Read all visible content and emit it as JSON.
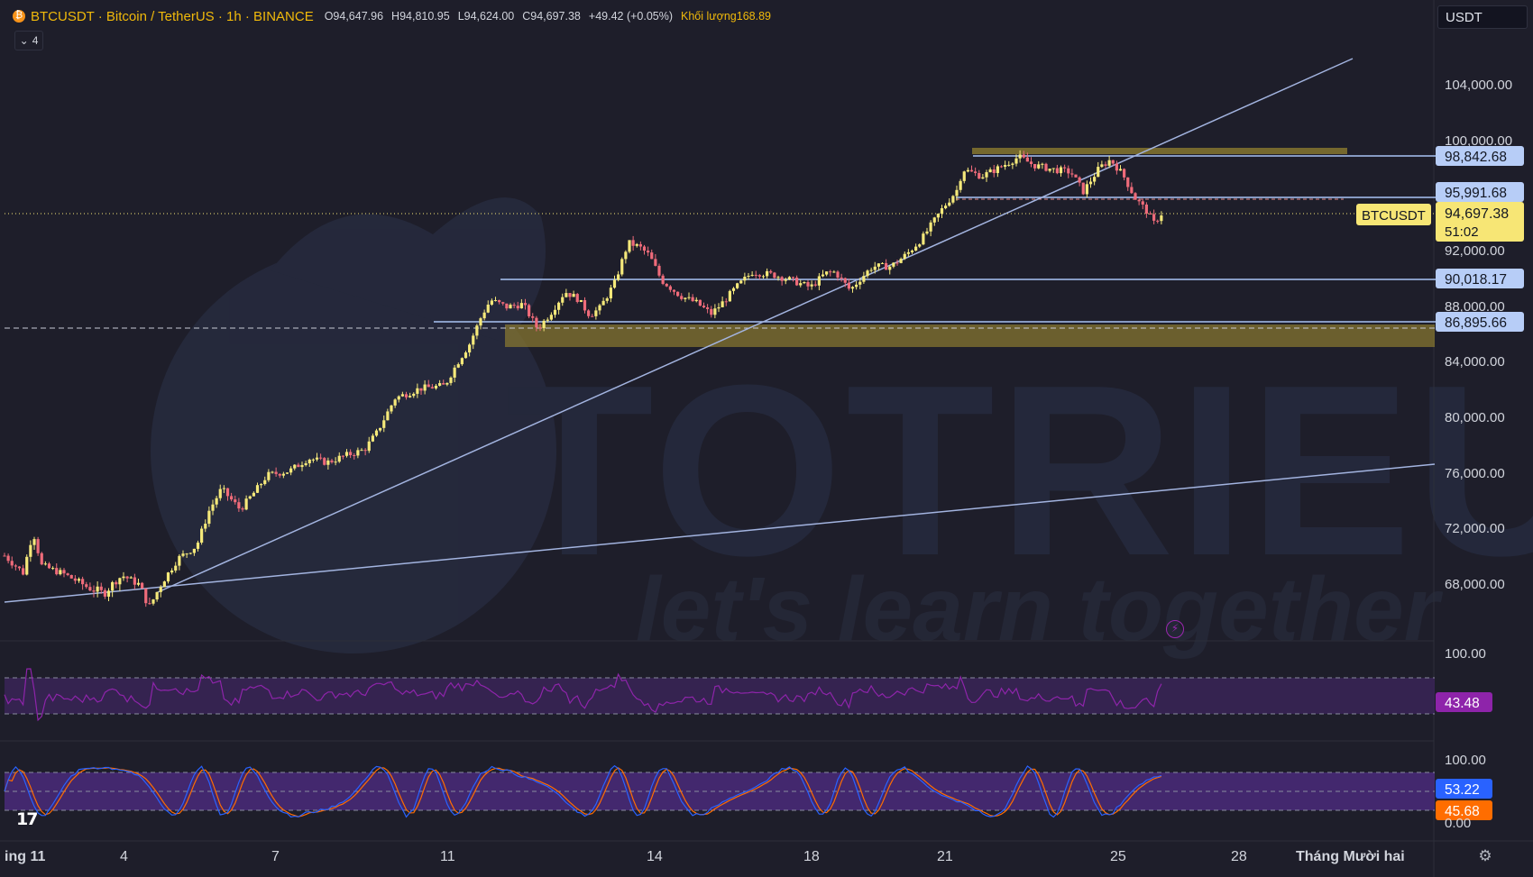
{
  "header": {
    "title": "BTCUSDT · Bitcoin / TetherUS · 1h · BINANCE",
    "open": "O94,647.96",
    "high": "H94,810.95",
    "low": "L94,624.00",
    "close": "C94,697.38",
    "change": "+49.42 (+0.05%)",
    "volume": "Khối lượng168.89",
    "indicators_toggle": "4"
  },
  "currency_selector": "USDT",
  "watermark": {
    "brand": "TOTRIEU",
    "tagline": "let's learn together"
  },
  "price_labels": {
    "symbol_tag": "BTCUSDT",
    "last_price": "94,697.38",
    "countdown": "51:02",
    "levels": [
      "98,842.68",
      "95,991.68",
      "90,018.17",
      "86,895.66"
    ]
  },
  "rsi": {
    "value": "43.48",
    "top_tick": "100.00"
  },
  "stoch_rsi": {
    "k": "53.22",
    "d": "45.68",
    "top_tick": "100.00",
    "bottom_tick": "0.00"
  },
  "colors": {
    "background": "#1e1e2a",
    "up": "#f5e97a",
    "down": "#ef6b7a",
    "trendline": "#a3b4e0",
    "level_line": "#a9c4f5",
    "zone": "#8b7a30",
    "rsi_line": "#8e24aa",
    "rsi_band": "#3a2457",
    "stoch_band": "#4a2a7a",
    "stoch_k": "#2962ff",
    "stoch_d": "#ff6d00",
    "label_bg": "#b7cdf7",
    "last_price_bg": "#f7e675"
  },
  "chart_data": {
    "type": "candlestick",
    "title": "BTCUSDT · Bitcoin / TetherUS · 1h · BINANCE",
    "y_axis_ticks": [
      "104,000.00",
      "100,000.00",
      "92,000.00",
      "88,000.00",
      "84,000.00",
      "80,000.00",
      "76,000.00",
      "72,000.00",
      "68,000.00"
    ],
    "x_axis_ticks": [
      "ing 11",
      "4",
      "7",
      "11",
      "14",
      "18",
      "21",
      "25",
      "28",
      "Tháng Mười hai"
    ],
    "price_path": [
      [
        0,
        70000
      ],
      [
        1.5,
        68800
      ],
      [
        2.3,
        71700
      ],
      [
        3,
        69300
      ],
      [
        4.8,
        68700
      ],
      [
        6.5,
        67900
      ],
      [
        8,
        67500
      ],
      [
        9.5,
        68600
      ],
      [
        10.8,
        68000
      ],
      [
        11.7,
        66800
      ],
      [
        14,
        69800
      ],
      [
        15.5,
        70700
      ],
      [
        16.5,
        73200
      ],
      [
        17.5,
        74800
      ],
      [
        19,
        73300
      ],
      [
        20.2,
        74600
      ],
      [
        21.2,
        75800
      ],
      [
        23,
        76100
      ],
      [
        24.5,
        77000
      ],
      [
        26,
        76700
      ],
      [
        27.5,
        77200
      ],
      [
        29,
        77600
      ],
      [
        30,
        78800
      ],
      [
        31.5,
        81300
      ],
      [
        33.5,
        82000
      ],
      [
        35.5,
        82200
      ],
      [
        36.5,
        83800
      ],
      [
        37.5,
        85200
      ],
      [
        38.5,
        87300
      ],
      [
        39.2,
        88400
      ],
      [
        40.5,
        87900
      ],
      [
        41.8,
        88100
      ],
      [
        43,
        86300
      ],
      [
        44,
        87400
      ],
      [
        45.2,
        89000
      ],
      [
        46.2,
        88500
      ],
      [
        47.2,
        87300
      ],
      [
        48,
        87800
      ],
      [
        49.2,
        89600
      ],
      [
        50.3,
        92500
      ],
      [
        51.2,
        92200
      ],
      [
        52,
        91600
      ],
      [
        53,
        89800
      ],
      [
        54.5,
        88700
      ],
      [
        55.8,
        88200
      ],
      [
        57,
        87400
      ],
      [
        57.8,
        88100
      ],
      [
        59,
        89300
      ],
      [
        60.3,
        90400
      ],
      [
        62,
        90200
      ],
      [
        63.5,
        89800
      ],
      [
        65,
        89300
      ],
      [
        66.2,
        90300
      ],
      [
        67,
        90400
      ],
      [
        68.2,
        89100
      ],
      [
        69,
        89900
      ],
      [
        70,
        90800
      ],
      [
        71.5,
        90800
      ],
      [
        72.8,
        91700
      ],
      [
        74,
        92800
      ],
      [
        75.6,
        94900
      ],
      [
        76.8,
        96300
      ],
      [
        77.3,
        97800
      ],
      [
        78.8,
        97300
      ],
      [
        80.2,
        97900
      ],
      [
        81.8,
        98700
      ],
      [
        83,
        98100
      ],
      [
        84.5,
        97800
      ],
      [
        86,
        97600
      ],
      [
        87,
        96200
      ],
      [
        88.3,
        97900
      ],
      [
        89.2,
        98500
      ],
      [
        90.2,
        97400
      ],
      [
        91.2,
        95700
      ],
      [
        92.3,
        94600
      ],
      [
        92.6,
        93800
      ],
      [
        93.4,
        94700
      ]
    ],
    "horizontal_levels": [
      98842.68,
      95991.68,
      90018.17,
      86895.66
    ],
    "last_price": 94697.38,
    "zones": [
      [
        98700,
        99500
      ],
      [
        85200,
        86800
      ]
    ],
    "rsi_last": 43.48,
    "stoch_k_last": 53.22,
    "stoch_d_last": 45.68
  }
}
